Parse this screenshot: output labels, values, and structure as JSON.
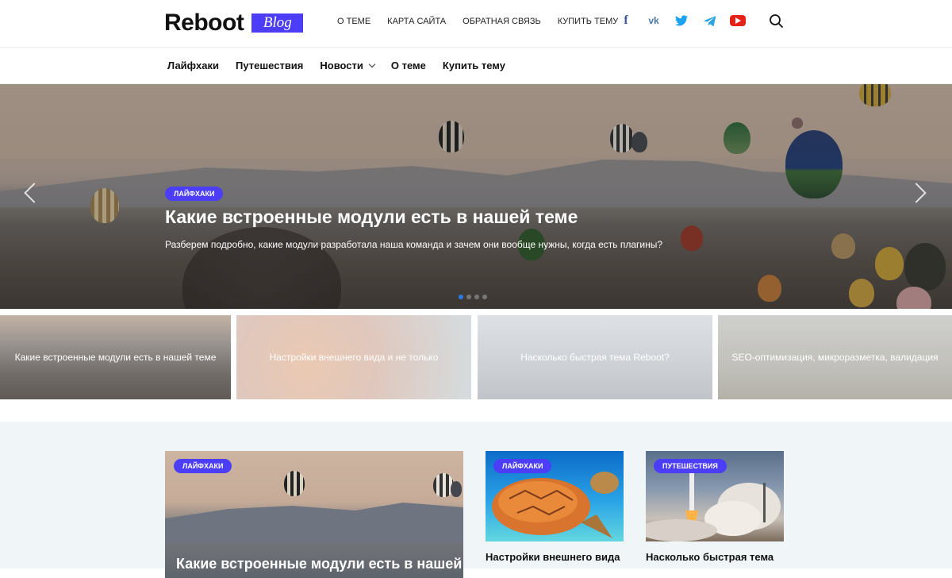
{
  "header": {
    "logo_text": "Reboot",
    "logo_badge": "Blog",
    "top_menu": [
      "О теме",
      "Карта сайта",
      "Обратная связь",
      "Купить тему"
    ],
    "socials": [
      {
        "name": "facebook-icon",
        "glyph": "f"
      },
      {
        "name": "vk-icon",
        "glyph": "vk"
      },
      {
        "name": "twitter-icon",
        "glyph": ""
      },
      {
        "name": "telegram-icon",
        "glyph": ""
      },
      {
        "name": "youtube-icon",
        "glyph": ""
      }
    ]
  },
  "nav": {
    "items": [
      "Лайфхаки",
      "Путешествия",
      "Новости",
      "О теме",
      "Купить тему"
    ]
  },
  "hero": {
    "tag": "Лайфхаки",
    "title": "Какие встроенные модули есть в нашей теме",
    "subtitle": "Разберем подробно, какие модули разработала наша команда и зачем они вообще нужны, когда есть плагины?",
    "active_slide": 1,
    "slide_count": 4
  },
  "strip": [
    "Какие встроенные модули есть в нашей теме",
    "Настройки внешнего вида и не только",
    "Насколько быстрая тема Reboot?",
    "SEO-оптимизация, микроразметка, валидация"
  ],
  "posts": {
    "big": {
      "tag": "Лайфхаки",
      "title": "Какие встроенные модули есть в нашей"
    },
    "cards": [
      {
        "tag": "Лайфхаки",
        "title": "Настройки внешнего вида"
      },
      {
        "tag": "Путешествия",
        "title": "Насколько быстрая тема"
      }
    ]
  },
  "colors": {
    "accent": "#4c3ef8",
    "active_dot": "#2c7be5"
  }
}
